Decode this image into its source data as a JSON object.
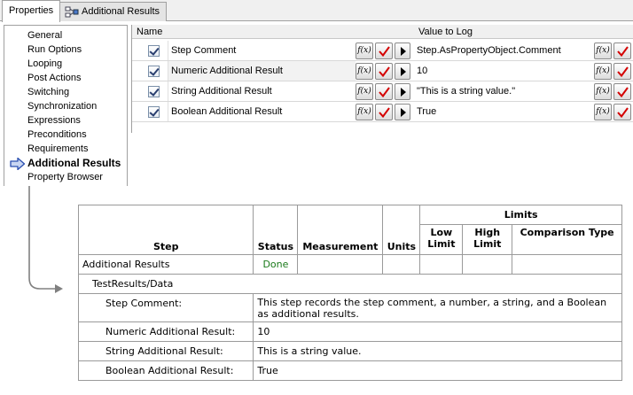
{
  "tabs": [
    {
      "label": "Properties",
      "icon": ""
    },
    {
      "label": "Additional Results",
      "icon": "additional-results-icon"
    }
  ],
  "sidebar": {
    "items": [
      {
        "label": "General"
      },
      {
        "label": "Run Options"
      },
      {
        "label": "Looping"
      },
      {
        "label": "Post Actions"
      },
      {
        "label": "Switching"
      },
      {
        "label": "Synchronization"
      },
      {
        "label": "Expressions"
      },
      {
        "label": "Preconditions"
      },
      {
        "label": "Requirements"
      },
      {
        "label": "Additional Results"
      },
      {
        "label": "Property Browser"
      }
    ],
    "selected": "Additional Results"
  },
  "grid": {
    "headers": {
      "name": "Name",
      "value": "Value to Log"
    },
    "rows": [
      {
        "name": "Step Comment",
        "value": "Step.AsPropertyObject.Comment",
        "checked": true
      },
      {
        "name": "Numeric Additional Result",
        "value": "10",
        "checked": true
      },
      {
        "name": "String Additional Result",
        "value": "\"This is a string value.\"",
        "checked": true
      },
      {
        "name": "Boolean Additional Result",
        "value": "True",
        "checked": true
      }
    ],
    "fx_label": "f(x)"
  },
  "report": {
    "headers": {
      "step": "Step",
      "status": "Status",
      "measurement": "Measurement",
      "units": "Units",
      "limits": "Limits",
      "low_limit": "Low Limit",
      "high_limit": "High Limit",
      "comparison_type": "Comparison Type"
    },
    "step_row": {
      "step": "Additional Results",
      "status": "Done"
    },
    "container": "TestResults/Data",
    "results": [
      {
        "label": "Step Comment:",
        "value": "This step records the step comment, a number, a string, and a Boolean as additional results."
      },
      {
        "label": "Numeric Additional Result:",
        "value": "10"
      },
      {
        "label": "String Additional Result:",
        "value": "This is a string value."
      },
      {
        "label": "Boolean Additional Result:",
        "value": "True"
      }
    ]
  },
  "colors": {
    "status_done": "#1a7a1a",
    "check_red": "#d40000",
    "arrow_blue": "#2a4fb0"
  }
}
